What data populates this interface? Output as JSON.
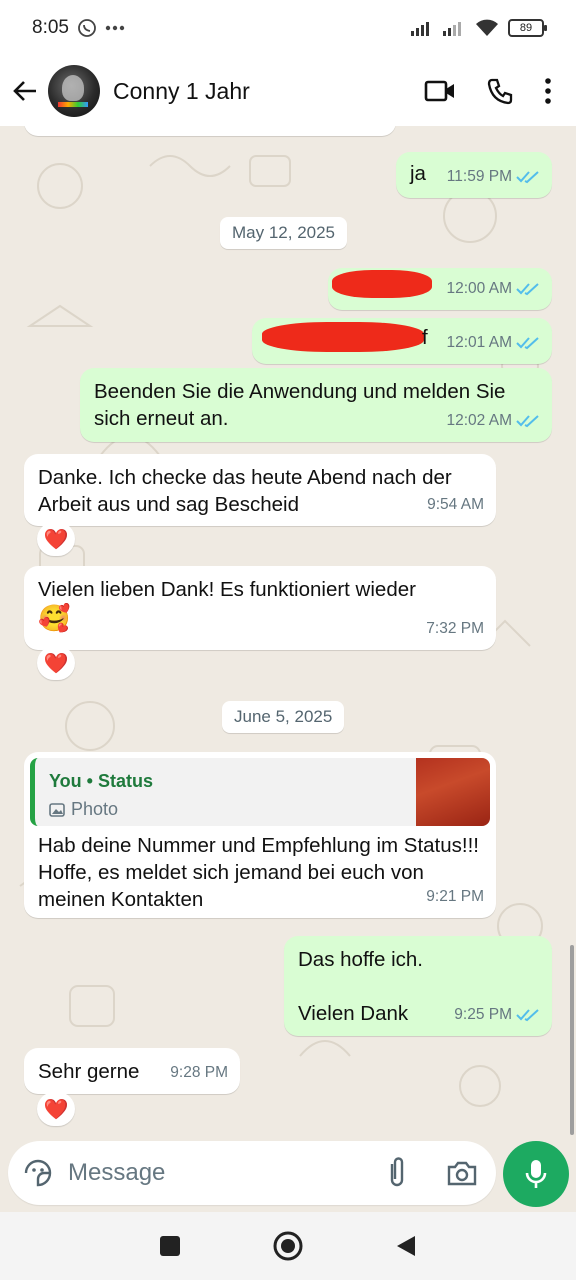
{
  "status_bar": {
    "time": "8:05",
    "battery": "89"
  },
  "header": {
    "contact_name": "Conny 1 Jahr"
  },
  "messages": [
    {
      "text": "ja",
      "time": "11:59 PM"
    },
    {
      "date": "May 12, 2025"
    },
    {
      "time": "12:00 AM"
    },
    {
      "partial": "f",
      "time": "12:01 AM"
    },
    {
      "text": "Beenden Sie die Anwendung und melden Sie sich erneut an.",
      "time": "12:02 AM"
    },
    {
      "text": "Danke. Ich checke das heute Abend nach der Arbeit aus und sag Bescheid",
      "time": "9:54 AM",
      "reaction": "❤️"
    },
    {
      "text": "Vielen lieben Dank! Es funktioniert wieder",
      "emoji": "🥰",
      "time": "7:32 PM",
      "reaction": "❤️"
    },
    {
      "date": "June 5, 2025"
    },
    {
      "quote_title": "You • Status",
      "quote_sub": "Photo",
      "text": "Hab deine Nummer und Empfehlung im Status!!! Hoffe, es meldet sich jemand bei euch von meinen Kontakten",
      "time": "9:21 PM"
    },
    {
      "line1": "Das hoffe ich.",
      "line2": "Vielen Dank",
      "time": "9:25 PM"
    },
    {
      "text": "Sehr gerne",
      "time": "9:28 PM",
      "reaction": "❤️"
    }
  ],
  "input": {
    "placeholder": "Message"
  },
  "colors": {
    "outgoing": "#d9fdd3",
    "incoming": "#ffffff",
    "accent": "#1daa61",
    "read_ticks": "#53bdeb"
  }
}
